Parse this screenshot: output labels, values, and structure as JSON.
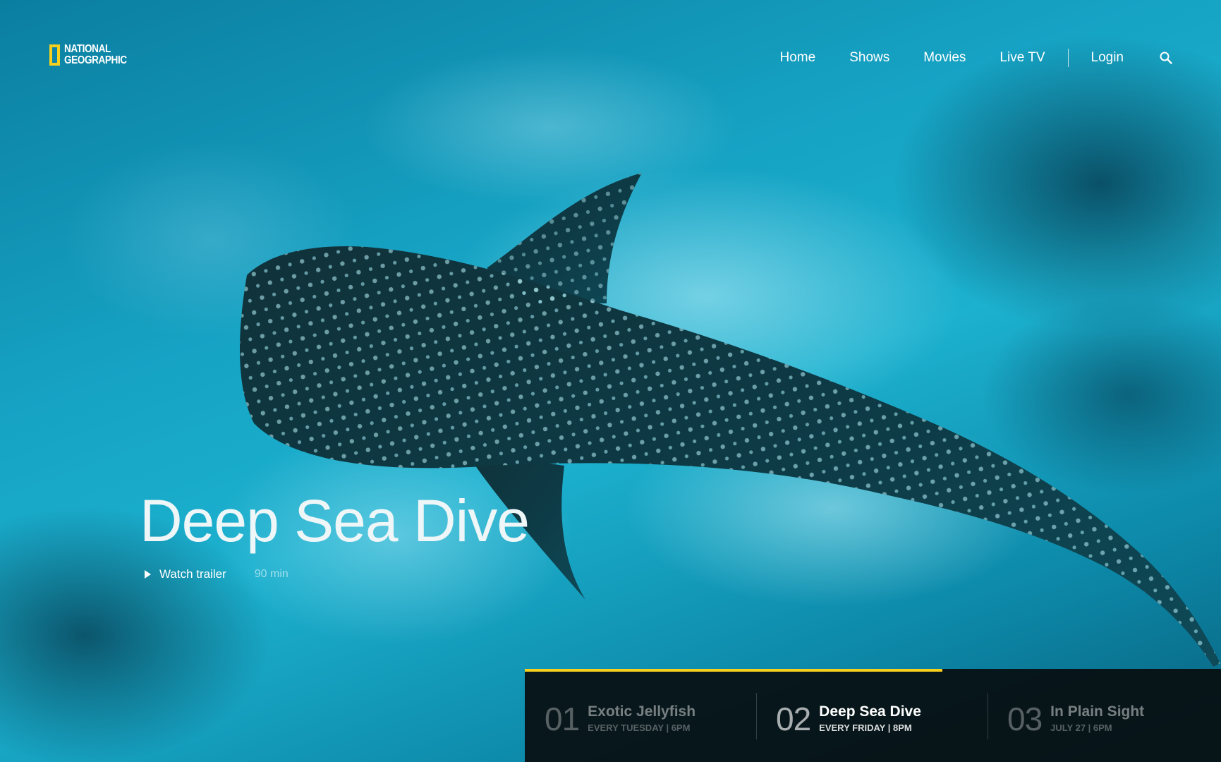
{
  "brand": {
    "logo_line1": "NATIONAL",
    "logo_line2": "GEOGRAPHIC",
    "accent_color": "#f7cf1d"
  },
  "nav": {
    "items": [
      {
        "label": "Home"
      },
      {
        "label": "Shows"
      },
      {
        "label": "Movies"
      },
      {
        "label": "Live TV"
      }
    ],
    "login_label": "Login",
    "search_icon": "search-icon"
  },
  "hero": {
    "title": "Deep Sea Dive",
    "watch_trailer_label": "Watch trailer",
    "duration": "90 min"
  },
  "episodes": {
    "progress_fraction": 0.6,
    "items": [
      {
        "number": "01",
        "title": "Exotic Jellyfish",
        "schedule": "EVERY TUESDAY | 6PM",
        "active": false
      },
      {
        "number": "02",
        "title": "Deep Sea Dive",
        "schedule": "EVERY FRIDAY | 8PM",
        "active": true
      },
      {
        "number": "03",
        "title": "In Plain Sight",
        "schedule": "JULY 27 | 6PM",
        "active": false
      }
    ]
  }
}
